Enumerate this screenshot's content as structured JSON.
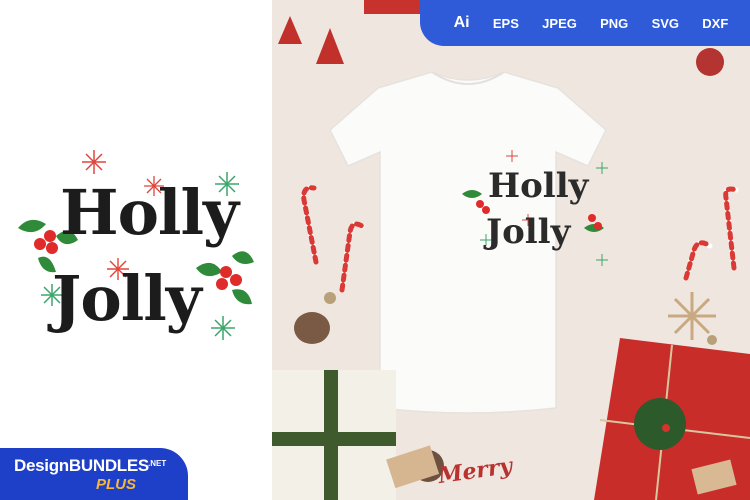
{
  "design": {
    "title_line1": "Holly",
    "title_line2": "Jolly"
  },
  "formats": [
    "Ai",
    "EPS",
    "JPEG",
    "PNG",
    "SVG",
    "DXF"
  ],
  "brand": {
    "name_part1": "Design",
    "name_part2": "BUNDLES",
    "tld": ".NET",
    "plus": "PLUS"
  },
  "props": {
    "gift_tag_text": "Merry"
  },
  "colors": {
    "holly_green": "#2f8a3a",
    "berry_red": "#e02b2b",
    "star_red": "#e0453c",
    "star_green": "#3aa66a",
    "text_dark": "#1c1c1c",
    "format_bar": "#2f5ad8",
    "badge_blue": "#1e3fc8",
    "plus_orange": "#f5b83c"
  }
}
